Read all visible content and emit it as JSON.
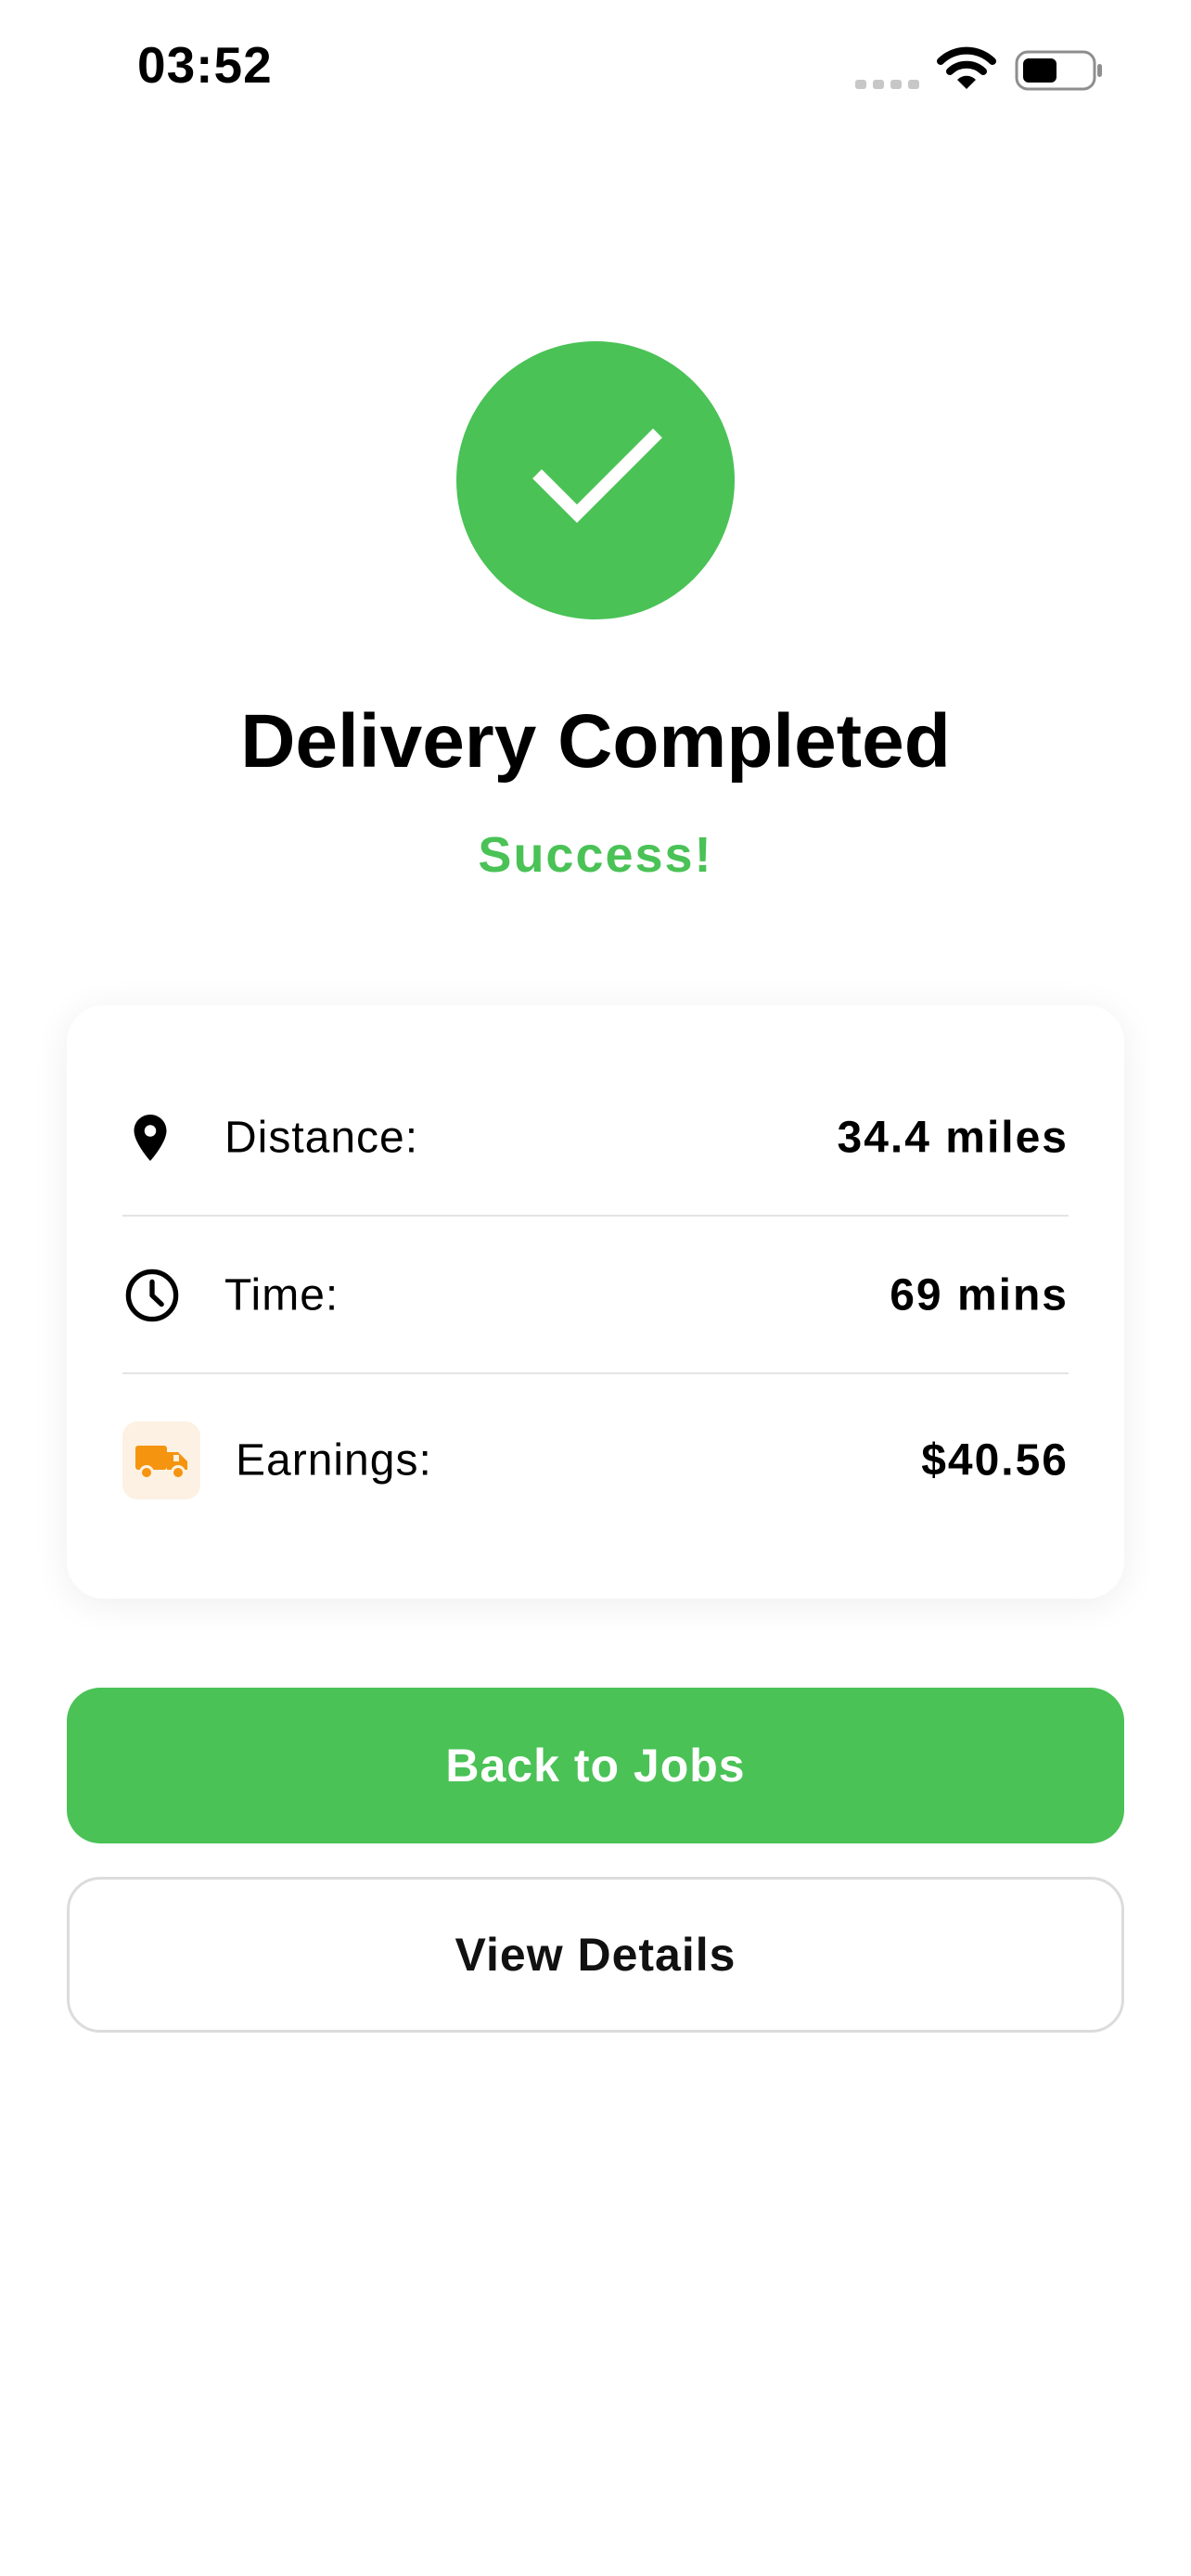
{
  "status_bar": {
    "time": "03:52",
    "icons": [
      "cellular-signal-icon",
      "wifi-icon",
      "battery-icon"
    ]
  },
  "colors": {
    "accent": "#4ac256",
    "earnings_icon": "#f5940f",
    "earnings_icon_bg": "#fdf1e3",
    "divider": "#e4e4e4"
  },
  "hero": {
    "icon": "checkmark-icon",
    "title": "Delivery Completed",
    "subtitle": "Success!"
  },
  "summary": {
    "rows": [
      {
        "icon": "location-pin-icon",
        "label": "Distance:",
        "value": "34.4 miles"
      },
      {
        "icon": "clock-icon",
        "label": "Time:",
        "value": "69 mins"
      },
      {
        "icon": "delivery-truck-icon",
        "label": "Earnings:",
        "value": "$40.56"
      }
    ]
  },
  "actions": {
    "primary_label": "Back to Jobs",
    "secondary_label": "View Details"
  }
}
